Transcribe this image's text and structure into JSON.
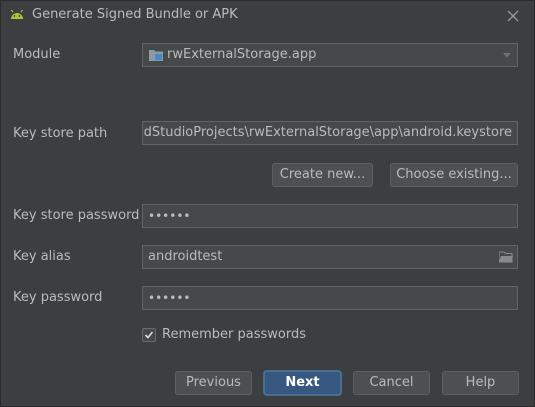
{
  "window": {
    "title": "Generate Signed Bundle or APK",
    "icon": "android-icon",
    "close_icon": "close-icon"
  },
  "form": {
    "module": {
      "label": "Module",
      "value": "rwExternalStorage.app",
      "icon": "module-folder-icon"
    },
    "key_store_path": {
      "label": "Key store path",
      "value": "ndroidStudioProjects\\rwExternalStorage\\app\\android.keystore"
    },
    "create_new_label": "Create new...",
    "choose_existing_label": "Choose existing...",
    "key_store_password": {
      "label": "Key store password",
      "masked_value": "••••••"
    },
    "key_alias": {
      "label": "Key alias",
      "value": "androidtest",
      "browse_icon": "folder-icon"
    },
    "key_password": {
      "label": "Key password",
      "masked_value": "••••••"
    },
    "remember_passwords": {
      "label": "Remember passwords",
      "checked": true
    }
  },
  "footer": {
    "previous_label": "Previous",
    "next_label": "Next",
    "cancel_label": "Cancel",
    "help_label": "Help"
  },
  "colors": {
    "background": "#3c3f41",
    "field_background": "#45494a",
    "field_border": "#646464",
    "text": "#bbbbbb",
    "primary_button": "#365880",
    "android_green": "#a4c639"
  }
}
